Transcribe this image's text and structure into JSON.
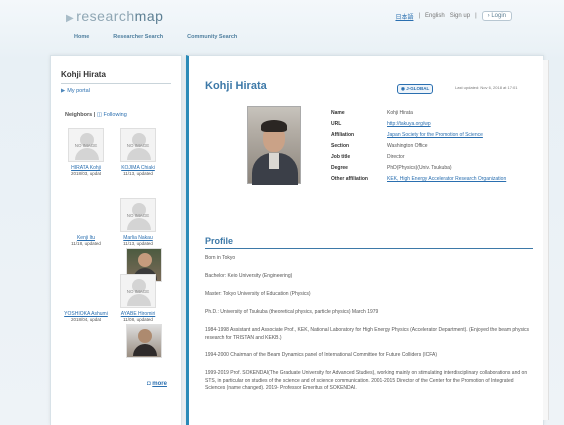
{
  "header": {
    "logo_prefix": "▶",
    "logo_light": "research",
    "logo_bold": "map",
    "lang_ja": "日本語",
    "lang_en": "English",
    "signup": "Sign up",
    "login": "Login"
  },
  "nav": {
    "home": "Home",
    "researcher_search": "Researcher Search",
    "community_search": "Community Search"
  },
  "sidebar": {
    "name": "Kohji Hirata",
    "my_portal": "My portal",
    "neighbors_label": "Neighbors",
    "following_label": "Following",
    "no_image": "NO IMAGE",
    "neighbors": [
      {
        "name": "HIRATA Kohji",
        "updated": "2018/03, updat"
      },
      {
        "name": "KOJIMA Chiaki",
        "updated": "11/13, updated"
      },
      {
        "name": "Kenji Itu",
        "updated": "11/18, updated"
      },
      {
        "name": "Marlia Nakau",
        "updated": "11/13, updated"
      },
      {
        "name": "YOSHIOKA Ashumi",
        "updated": "2018/04, updat"
      },
      {
        "name": "AYABE Hiromiri",
        "updated": "11/08, updated"
      }
    ],
    "more": "more"
  },
  "main": {
    "title": "Kohji Hirata",
    "badge": "J-GLOBAL",
    "last_updated": "Last updated: Nov 6, 2018 at 17:01",
    "info": [
      {
        "label": "Name",
        "value": "Kohji Hirata",
        "link": false
      },
      {
        "label": "URL",
        "value": "http://takuya.org/wp",
        "link": true
      },
      {
        "label": "Affiliation",
        "value": "Japan Society for the Promotion of Science",
        "link": true
      },
      {
        "label": "Section",
        "value": "Washington Office",
        "link": false
      },
      {
        "label": "Job title",
        "value": "Director",
        "link": false
      },
      {
        "label": "Degree",
        "value": "PhD(Physics)(Univ. Tsukuba)",
        "link": false
      },
      {
        "label": "Other affiliation",
        "value": "KEK, High Energy Accelerator Research Organization",
        "link": true
      }
    ],
    "profile_heading": "Profile",
    "profile": [
      "Born in Tokyo",
      "Bachelor: Keio University (Engineering)",
      "Master: Tokyo University of Education (Physics)",
      "Ph.D.: University of Tsukuba (theoretical physics, particle physics) March 1979",
      "1984-1998 Assistant and Associate Prof., KEK, National Laboratory for High Energy Physics (Accelerator Department). (Enjoyed the beam physics research for TRISTAN and KEKB.)",
      "1994-2000 Chairman of the Beam Dynamics panel of International Committee for Future Colliders (ICFA)",
      "1999-2019 Prof. SOKENDAI(The Graduate University for Advanced Studies), working mainly on stimulating interdisciplinary collaborations and on STS, in particular on studies of the science and of science communication. 2001-2015 Director of the Center for the Promotion of Integrated Sciences (name changed). 2019- Professor Emeritus of SOKENDAI."
    ]
  },
  "colors": {
    "accent": "#3d79a8",
    "link": "#2a6fb0",
    "card_border": "#2a8ab8"
  }
}
